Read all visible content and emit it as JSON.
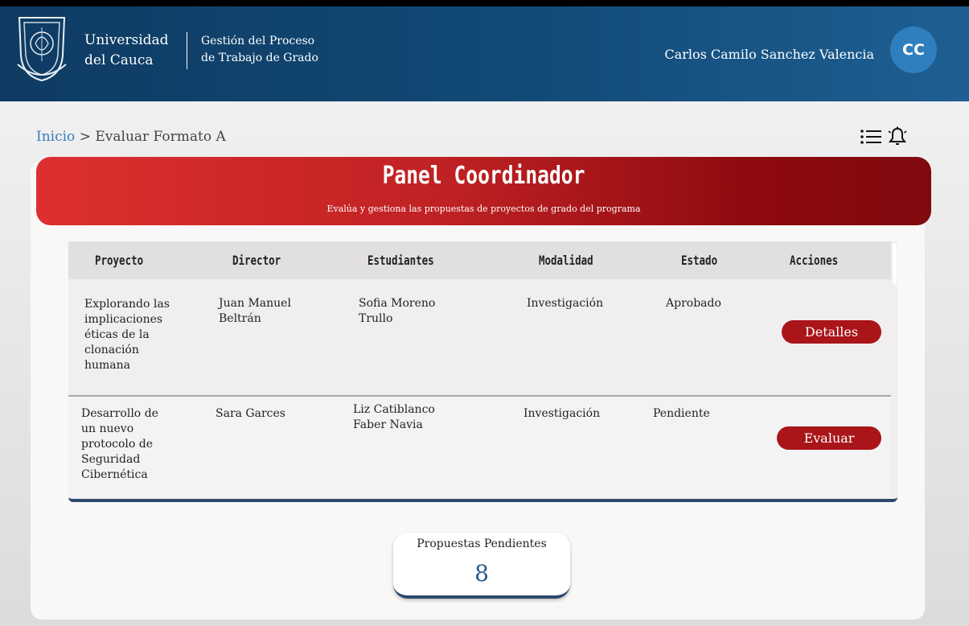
{
  "header": {
    "university_line1": "Universidad",
    "university_line2": "del Cauca",
    "process_line1": "Gestión del Proceso",
    "process_line2": "de Trabajo de Grado",
    "user_name": "Carlos Camilo Sanchez Valencia",
    "avatar_initials": "CC",
    "colors": {
      "header_bg": "#124a77",
      "avatar_bg": "#2f7fbe"
    }
  },
  "breadcrumb": {
    "home": "Inicio",
    "separator": " > ",
    "current": "Evaluar Formato A"
  },
  "toolbar": {
    "icons": [
      "list-icon",
      "bell-icon"
    ]
  },
  "banner": {
    "title": "Panel Coordinador",
    "subtitle": "Evalúa y gestiona las propuestas de proyectos de grado del programa",
    "color": "#c02224"
  },
  "table": {
    "headers": [
      "Proyecto",
      "Director",
      "Estudiantes",
      "Modalidad",
      "Estado",
      "Acciones"
    ],
    "rows": [
      {
        "project": [
          "Explorando las",
          "implicaciones",
          "éticas de la",
          "clonación",
          "humana"
        ],
        "director": [
          "Juan Manuel",
          "Beltrán"
        ],
        "students": [
          "Sofia Moreno",
          "Trullo"
        ],
        "modality": "Investigación",
        "status": "Aprobado",
        "action": "Detalles"
      },
      {
        "project": [
          "Desarrollo de",
          "un nuevo",
          "protocolo de",
          "Seguridad",
          "Cibernética"
        ],
        "director": [
          "Sara Garces"
        ],
        "students": [
          "Liz Catiblanco",
          "Faber Navia"
        ],
        "modality": "Investigación",
        "status": "Pendiente",
        "action": "Evaluar"
      }
    ]
  },
  "pending": {
    "label": "Propuestas Pendientes",
    "count": "8"
  }
}
